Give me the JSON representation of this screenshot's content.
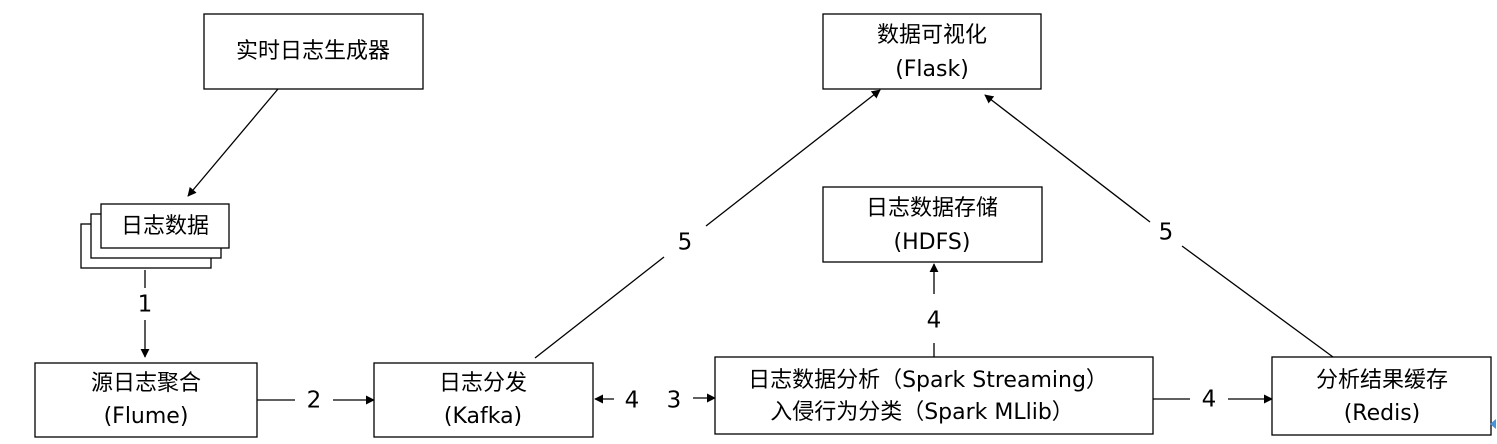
{
  "nodes": {
    "log_generator": {
      "line1": "实时日志生成器"
    },
    "log_data": {
      "line1": "日志数据"
    },
    "flume": {
      "line1": "源日志聚合",
      "line2": "(Flume)"
    },
    "kafka": {
      "line1": "日志分发",
      "line2": "(Kafka)"
    },
    "spark": {
      "line1": "日志数据分析（Spark Streaming）",
      "line2": "入侵行为分类（Spark MLlib）"
    },
    "redis": {
      "line1": "分析结果缓存",
      "line2": "(Redis)"
    },
    "hdfs": {
      "line1": "日志数据存储",
      "line2": "(HDFS)"
    },
    "flask": {
      "line1": "数据可视化",
      "line2": "(Flask)"
    }
  },
  "edges": {
    "e1": "1",
    "e2": "2",
    "e3": "3",
    "e4_kafka": "4",
    "e4_hdfs": "4",
    "e4_redis": "4",
    "e5_kafka": "5",
    "e5_redis": "5"
  }
}
